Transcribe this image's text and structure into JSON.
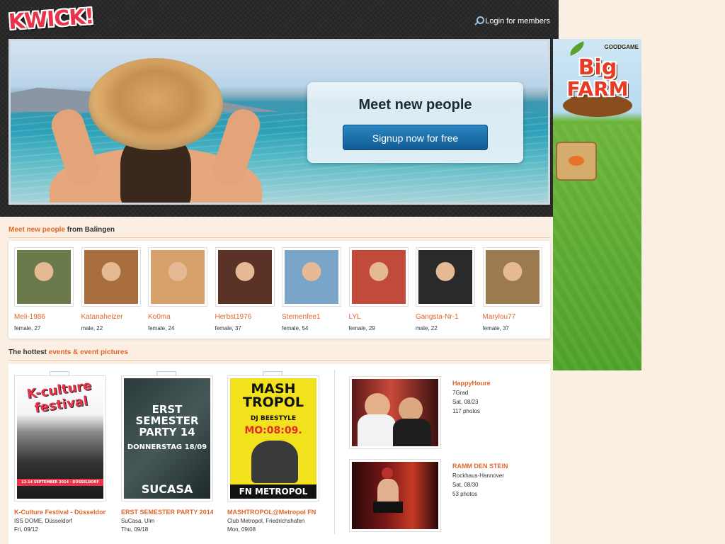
{
  "header": {
    "logo": "KWICK!",
    "login_label": "Login for members"
  },
  "hero": {
    "title": "Meet new people",
    "signup_label": "Signup now for free"
  },
  "ad": {
    "brand": "GOODGAME",
    "title_line1": "Big",
    "title_line2": "FARM"
  },
  "people_section": {
    "prefix": "Meet new people",
    "suffix": " from Balingen",
    "people": [
      {
        "name": "Meli-1986",
        "info": "female, 27",
        "color": "#6b7a4a"
      },
      {
        "name": "Katanaheizer",
        "info": "male, 22",
        "color": "#a86e3e"
      },
      {
        "name": "Ko0ma",
        "info": "female, 24",
        "color": "#d6a06a"
      },
      {
        "name": "Herbst1976",
        "info": "female, 37",
        "color": "#5a3226"
      },
      {
        "name": "Sternenfee1",
        "info": "female, 54",
        "color": "#7aa4c8"
      },
      {
        "name": "LYL",
        "info": "female, 29",
        "color": "#c24a3a"
      },
      {
        "name": "Gangsta-Nr-1",
        "info": "male, 22",
        "color": "#2a2a2a"
      },
      {
        "name": "Marylou77",
        "info": "female, 37",
        "color": "#9a7a4e"
      }
    ]
  },
  "events_section": {
    "prefix": "The hottest ",
    "highlight": "events & event pictures",
    "events": [
      {
        "title": "K-Culture Festival - Düsseldorf",
        "location": "ISS DOME, Düsseldorf",
        "date": "Fri, 09/12",
        "poster_text": "K-culture festival",
        "poster_sub": "12-14 SEPTEMBER 2014 · DÜSSELDORF"
      },
      {
        "title": "ERST SEMESTER PARTY 2014:",
        "location": "SuCasa, Ulm",
        "date": "Thu, 09/18",
        "poster_text": "ERST SEMESTER PARTY 14",
        "poster_sub": "DONNERSTAG 18/09",
        "poster_foot": "SUCASA"
      },
      {
        "title": "MASHTROPOL@Metropol FN",
        "location": "Club Metropol, Friedrichshafen",
        "date": "Mon, 09/08",
        "poster_text": "MASH TROPOL",
        "poster_sub": "DJ BEESTYLE",
        "poster_date": "MO:08:09.",
        "poster_foot": "FN METROPOL"
      }
    ],
    "photos": [
      {
        "title": "HappyHoure",
        "location": "7Grad",
        "date": "Sat, 08/23",
        "count": "117 photos"
      },
      {
        "title": "RAMM DEN STEIN",
        "location": "Rockhaus-Hannover",
        "date": "Sat, 08/30",
        "count": "53 photos"
      }
    ]
  }
}
